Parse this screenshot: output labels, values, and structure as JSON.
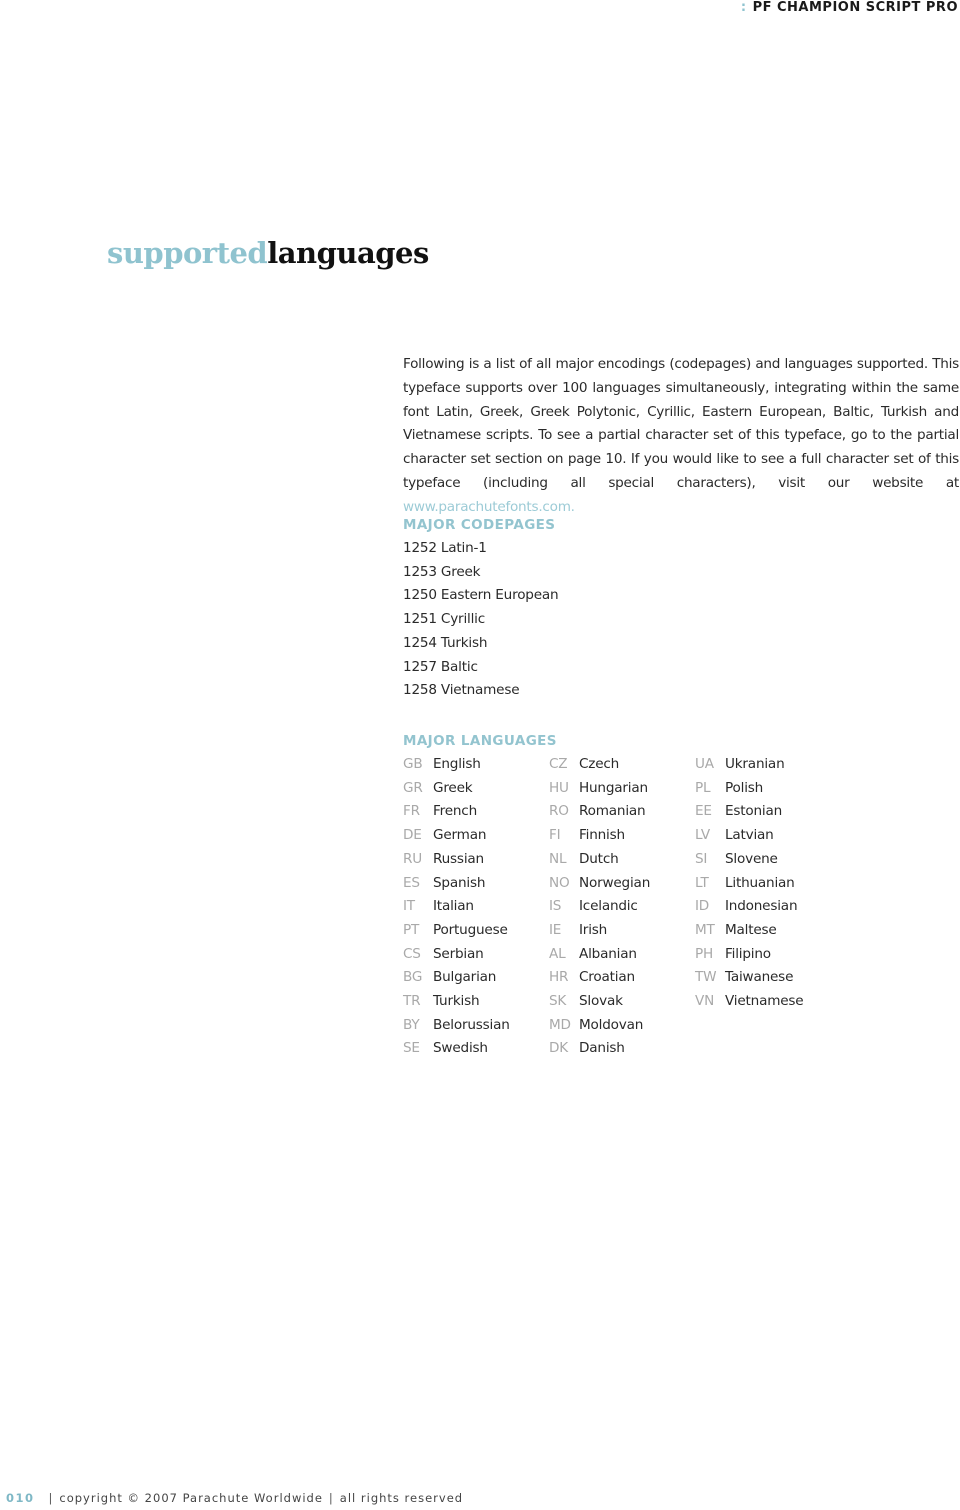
{
  "header": {
    "bullet_icon": "colon-dots-icon",
    "brand": "PF CHAMPION SCRIPT PRO"
  },
  "title": {
    "accent": "supported",
    "main": "languages"
  },
  "intro": {
    "text": "Following is a list of all major encodings (codepages) and languages supported. This typeface supports over 100 languages simultaneously, integrating within the same font Latin, Greek, Greek Polytonic, Cyrillic, Eastern European, Baltic, Turkish and Vietnamese scripts. To see a partial character set of this typeface, go to the partial character set section on page 10. If you would like to see a full character set of this typeface (including all special characters), visit our website at ",
    "link": "www.parachutefonts.com."
  },
  "codepages": {
    "heading": "MAJOR CODEPAGES",
    "items": [
      "1252 Latin-1",
      "1253 Greek",
      "1250 Eastern European",
      "1251 Cyrillic",
      "1254 Turkish",
      "1257 Baltic",
      "1258 Vietnamese"
    ]
  },
  "languages": {
    "heading": "MAJOR LANGUAGES",
    "columns": [
      [
        {
          "code": "GB",
          "name": "English"
        },
        {
          "code": "GR",
          "name": "Greek"
        },
        {
          "code": "FR",
          "name": "French"
        },
        {
          "code": "DE",
          "name": "German"
        },
        {
          "code": "RU",
          "name": "Russian"
        },
        {
          "code": "ES",
          "name": "Spanish"
        },
        {
          "code": "IT",
          "name": "Italian"
        },
        {
          "code": "PT",
          "name": "Portuguese"
        },
        {
          "code": "CS",
          "name": "Serbian"
        },
        {
          "code": "BG",
          "name": "Bulgarian"
        },
        {
          "code": "TR",
          "name": "Turkish"
        },
        {
          "code": "BY",
          "name": "Belorussian"
        },
        {
          "code": "SE",
          "name": "Swedish"
        }
      ],
      [
        {
          "code": "CZ",
          "name": "Czech"
        },
        {
          "code": "HU",
          "name": "Hungarian"
        },
        {
          "code": "RO",
          "name": "Romanian"
        },
        {
          "code": "FI",
          "name": "Finnish"
        },
        {
          "code": "NL",
          "name": "Dutch"
        },
        {
          "code": "NO",
          "name": "Norwegian"
        },
        {
          "code": "IS",
          "name": "Icelandic"
        },
        {
          "code": "IE",
          "name": "Irish"
        },
        {
          "code": "AL",
          "name": "Albanian"
        },
        {
          "code": "HR",
          "name": "Croatian"
        },
        {
          "code": "SK",
          "name": "Slovak"
        },
        {
          "code": "MD",
          "name": "Moldovan"
        },
        {
          "code": "DK",
          "name": "Danish"
        }
      ],
      [
        {
          "code": "UA",
          "name": "Ukranian"
        },
        {
          "code": "PL",
          "name": "Polish"
        },
        {
          "code": "EE",
          "name": "Estonian"
        },
        {
          "code": "LV",
          "name": "Latvian"
        },
        {
          "code": "SI",
          "name": "Slovene"
        },
        {
          "code": "LT",
          "name": "Lithuanian"
        },
        {
          "code": "ID",
          "name": "Indonesian"
        },
        {
          "code": "MT",
          "name": "Maltese"
        },
        {
          "code": "PH",
          "name": "Filipino"
        },
        {
          "code": "TW",
          "name": "Taiwanese"
        },
        {
          "code": "VN",
          "name": "Vietnamese"
        }
      ]
    ]
  },
  "footer": {
    "page_number": "010",
    "separator": "|",
    "copyright": "copyright © 2007 Parachute Worldwide",
    "rights": "all rights reserved"
  },
  "colors": {
    "accent": "#8fc3cf",
    "text": "#2a2a2a",
    "code_gray": "#a9a9a9"
  }
}
